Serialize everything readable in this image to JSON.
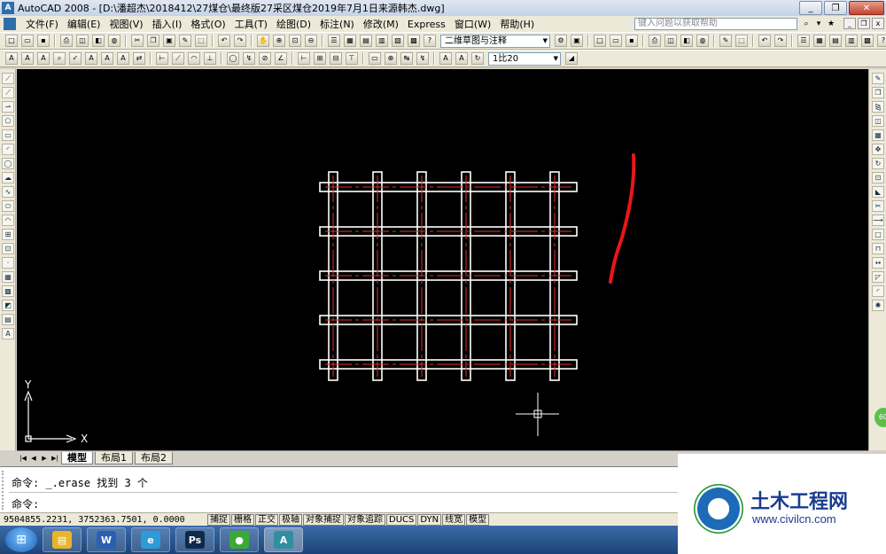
{
  "titlebar": {
    "app_icon": "A",
    "title": "AutoCAD 2008 - [D:\\潘超杰\\2018412\\27煤仓\\最终版27采区煤仓2019年7月1日来源韩杰.dwg]",
    "minimize": "_",
    "maximize": "❐",
    "close": "✕"
  },
  "menubar": {
    "items": [
      "文件(F)",
      "编辑(E)",
      "视图(V)",
      "插入(I)",
      "格式(O)",
      "工具(T)",
      "绘图(D)",
      "标注(N)",
      "修改(M)",
      "Express",
      "窗口(W)",
      "帮助(H)"
    ],
    "help_placeholder": "键入问题以获取帮助"
  },
  "toolbar1": {
    "workspace": "二维草图与注释"
  },
  "toolbar2": {
    "dimstyle": "1比20"
  },
  "canvas": {
    "axis_x": "X",
    "axis_y": "Y",
    "background": "#000000",
    "line_color": "#ffffff",
    "center_color": "#e0302a",
    "annotation_color": "#e8171a"
  },
  "tabs": {
    "items": [
      "模型",
      "布局1",
      "布局2"
    ],
    "active": "模型"
  },
  "command": {
    "history": "命令: _.erase 找到 3 个",
    "prompt": "命令:"
  },
  "status": {
    "coords": "9504855.2231, 3752363.7501, 0.0000",
    "buttons": [
      "捕捉",
      "栅格",
      "正交",
      "极轴",
      "对象捕捉",
      "对象追踪",
      "DUCS",
      "DYN",
      "线宽",
      "模型"
    ]
  },
  "taskbar": {
    "apps": [
      {
        "name": "explorer",
        "glyph": "▤",
        "color": "#e8b52a"
      },
      {
        "name": "word",
        "glyph": "W",
        "color": "#2b5fb0"
      },
      {
        "name": "ie",
        "glyph": "e",
        "color": "#2e9ad8"
      },
      {
        "name": "photoshop",
        "glyph": "Ps",
        "color": "#0f2a4a"
      },
      {
        "name": "wechat",
        "glyph": "●",
        "color": "#3aa935"
      },
      {
        "name": "autocad",
        "glyph": "A",
        "color": "#2f8fa0"
      }
    ]
  },
  "watermark": {
    "title": "土木工程网",
    "url": "www.civilcn.com"
  },
  "zoom_badge": "60"
}
